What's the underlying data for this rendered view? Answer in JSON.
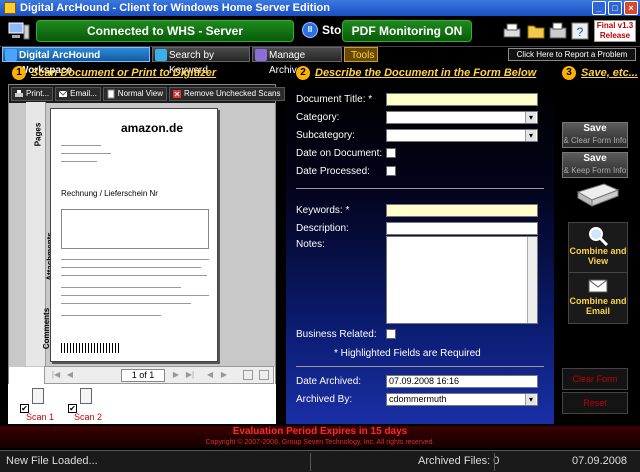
{
  "window": {
    "title": "Digital ArcHound - Client for Windows Home Server Edition"
  },
  "header": {
    "server_status": "Connected to WHS - Server",
    "stop_label": "Stop",
    "stop_icon_text": "II",
    "pdf_status": "PDF Monitoring ON",
    "release_badge_line1": "Final v1.3",
    "release_badge_line2": "Release",
    "icons": [
      "server-icon",
      "printer-icon",
      "folder-icon",
      "fax-icon",
      "help-icon"
    ]
  },
  "tabs": [
    {
      "label": "Digital ArcHound Workspace",
      "active": true
    },
    {
      "label": "Search by Keyword",
      "active": false
    },
    {
      "label": "Manage Archives",
      "active": false
    },
    {
      "label": "Tools",
      "active": false
    }
  ],
  "report_link": "Click Here to Report a Problem",
  "steps": {
    "one": {
      "num": "1",
      "text": "Scan Document or Print to Digitizer"
    },
    "two": {
      "num": "2",
      "text": "Describe the Document in the Form Below"
    },
    "three": {
      "num": "3",
      "text": "Save, etc..."
    }
  },
  "viewer": {
    "toolbar": [
      "Print...",
      "Email...",
      "Normal View",
      "Remove Unchecked Scans"
    ],
    "side_tabs": [
      "Pages",
      "Attachments",
      "Comments"
    ],
    "doc_logo": "amazon.de",
    "doc_heading": "Rechnung / Lieferschein Nr",
    "page_indicator": "1 of 1",
    "thumbs": [
      {
        "label": "Scan 1",
        "checked": "✔"
      },
      {
        "label": "Scan 2",
        "checked": "✔"
      }
    ]
  },
  "form": {
    "title_label": "Document Title:  *",
    "category_label": "Category:",
    "subcategory_label": "Subcategory:",
    "date_on_doc_label": "Date on Document:",
    "date_processed_label": "Date Processed:",
    "keywords_label": "Keywords:  *",
    "description_label": "Description:",
    "notes_label": "Notes:",
    "business_label": "Business Related:",
    "required_note": "* Highlighted Fields are Required",
    "date_archived_label": "Date Archived:",
    "date_archived_value": "07.09.2008 16:16",
    "archived_by_label": "Archived By:",
    "archived_by_value": "cdommermuth"
  },
  "actions": {
    "save1": {
      "label": "Save",
      "sub": "& Clear Form Info"
    },
    "save2": {
      "label": "Save",
      "sub": "& Keep Form Info"
    },
    "combine_view": "Combine and View",
    "combine_email": "Combine and Email",
    "clear_form": "Clear Form",
    "reset": "Reset"
  },
  "footer": {
    "eval_text": "Evaluation Period Expires in 15 days",
    "copyright": "Copyright © 2007-2008,  Group Seven Technology, Inc.  All rights reserved.",
    "status_left": "New File Loaded...",
    "archived_files": "Archived Files: 0",
    "date": "07.09.2008"
  },
  "colors": {
    "accent": "#ffd24a",
    "status_green": "#1f8a1f",
    "warning_red": "#ff2a2a"
  }
}
